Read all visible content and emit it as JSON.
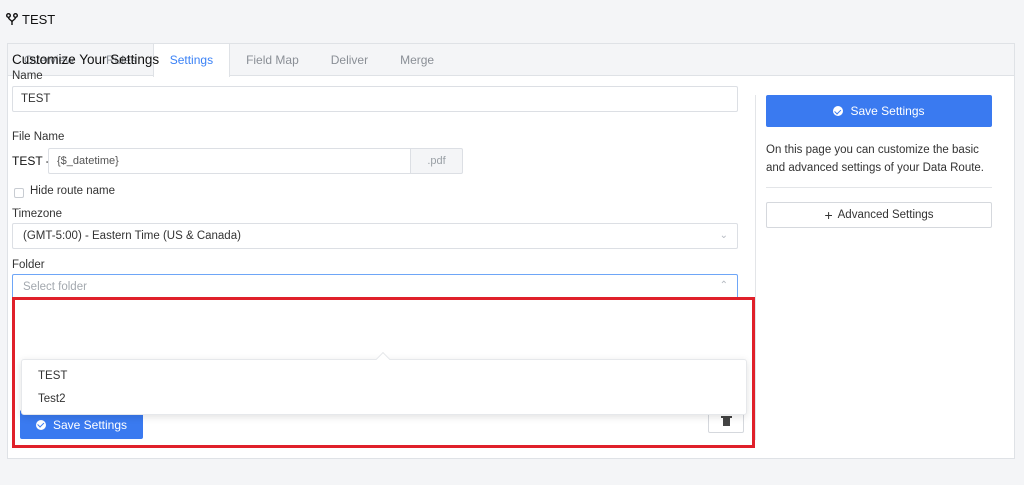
{
  "header": {
    "title": "TEST",
    "icon": "route-fork-icon"
  },
  "tabs": [
    {
      "label": "Overview"
    },
    {
      "label": "Rules"
    },
    {
      "label": "Settings",
      "active": true
    },
    {
      "label": "Field Map"
    },
    {
      "label": "Deliver"
    },
    {
      "label": "Merge"
    }
  ],
  "form": {
    "section_title": "Customize Your Settings",
    "name": {
      "label": "Name",
      "value": "TEST"
    },
    "file_name": {
      "label": "File Name",
      "prefix": "TEST -",
      "value": "{$_datetime}",
      "suffix": ".pdf"
    },
    "hide_route": {
      "label": "Hide route name",
      "checked": false
    },
    "timezone": {
      "label": "Timezone",
      "value": "(GMT-5:00) - Eastern Time (US & Canada)"
    },
    "folder": {
      "label": "Folder",
      "placeholder": "Select folder",
      "options": [
        "TEST",
        "Test2"
      ]
    },
    "save_label": "Save Settings"
  },
  "sidebar": {
    "save_label": "Save Settings",
    "description": "On this page you can customize the basic and advanced settings of your Data Route.",
    "advanced_label": "Advanced Settings"
  },
  "colors": {
    "accent": "#3a7af0",
    "highlight": "#e0202a",
    "active_tab": "#3b82f6"
  }
}
